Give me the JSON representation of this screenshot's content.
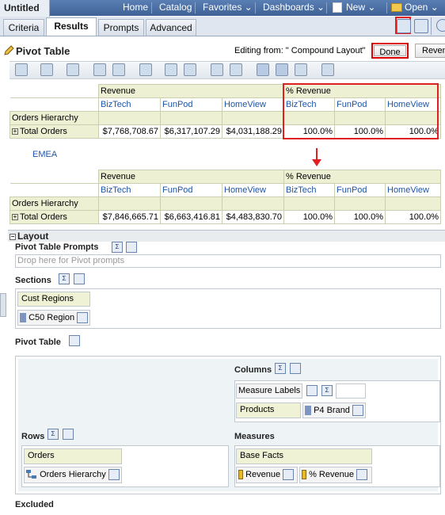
{
  "header": {
    "title": "Untitled",
    "nav": [
      {
        "label": "Home"
      },
      {
        "label": "Catalog"
      },
      {
        "label": "Favorites ⌄"
      },
      {
        "label": "Dashboards ⌄"
      },
      {
        "label": "New ⌄"
      },
      {
        "label": "Open ⌄"
      }
    ]
  },
  "tabs": [
    {
      "label": "Criteria"
    },
    {
      "label": "Results"
    },
    {
      "label": "Prompts"
    },
    {
      "label": "Advanced"
    }
  ],
  "pivot": {
    "title": "Pivot Table",
    "editing": "Editing from: \" Compound Layout\"",
    "done": "Done",
    "revert": "Reven"
  },
  "table1": {
    "measure1": "Revenue",
    "measure2": "% Revenue",
    "brands": [
      "BizTech",
      "FunPod",
      "HomeView",
      "BizTech",
      "FunPod",
      "HomeView"
    ],
    "row_hdr": "Orders Hierarchy",
    "row_label": "Total Orders",
    "values": [
      "$7,768,708.67",
      "$6,317,107.29",
      "$4,031,188.29",
      "100.0%",
      "100.0%",
      "100.0%"
    ]
  },
  "emea": "EMEA",
  "table2": {
    "measure1": "Revenue",
    "measure2": "% Revenue",
    "brands": [
      "BizTech",
      "FunPod",
      "HomeView",
      "BizTech",
      "FunPod",
      "HomeView"
    ],
    "row_hdr": "Orders Hierarchy",
    "row_label": "Total Orders",
    "values": [
      "$7,846,665.71",
      "$6,663,416.81",
      "$4,483,830.70",
      "100.0%",
      "100.0%",
      "100.0%"
    ]
  },
  "layout": {
    "title": "Layout",
    "pivot_prompts": "Pivot Table Prompts",
    "drop_placeholder": "Drop here for Pivot prompts",
    "sections": "Sections",
    "cust_regions": "Cust Regions",
    "c50_region": "C50 Region",
    "pivot_table": "Pivot Table",
    "columns": "Columns",
    "measure_labels": "Measure Labels",
    "products": "Products",
    "p4_brand": "P4 Brand",
    "rows": "Rows",
    "orders": "Orders",
    "orders_hierarchy": "Orders Hierarchy",
    "measures": "Measures",
    "base_facts": "Base Facts",
    "revenue": "Revenue",
    "pct_revenue": "% Revenue",
    "excluded": "Excluded"
  },
  "icons": {
    "sigma": "Σ"
  }
}
